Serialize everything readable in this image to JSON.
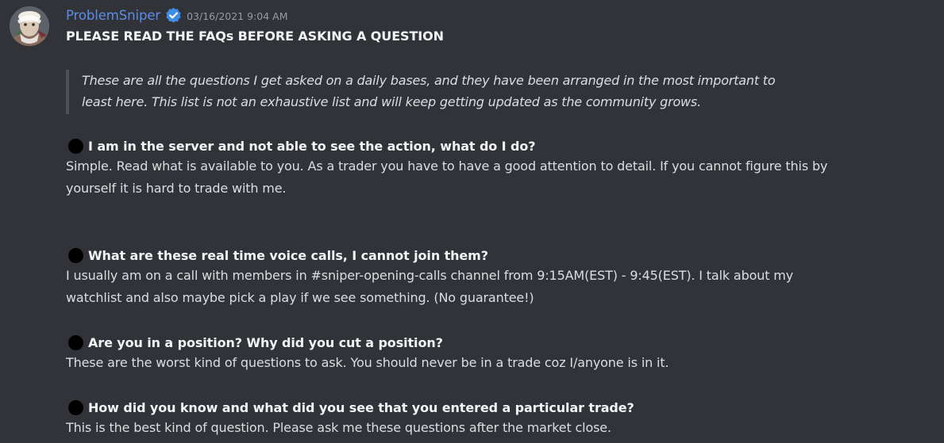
{
  "message": {
    "author": "ProblemSniper",
    "timestamp": "03/16/2021 9:04 AM",
    "avatar_icon": "avatar-image",
    "verified_icon": "verified-badge-icon",
    "title": "PLEASE READ THE FAQs BEFORE ASKING A QUESTION",
    "quote_lines": [
      "These are all the questions I get asked on a daily bases, and they have been arranged in the most important to",
      "least here. This list is not an exhaustive list and will keep getting updated as the community grows."
    ],
    "faqs": [
      {
        "question": "I am in the server and not able to see the action, what do I do?",
        "answer_lines": [
          "Simple. Read what is available to you. As a trader you have to have a good attention to detail. If you cannot figure this by",
          "yourself it is hard to trade with me."
        ]
      },
      {
        "question": "What are these real time voice calls, I cannot join them?",
        "answer_lines": [
          "I usually am on a call with members in #sniper-opening-calls channel from 9:15AM(EST) - 9:45(EST). I talk about my",
          "watchlist and also maybe pick a play if we see something. (No guarantee!)"
        ]
      },
      {
        "question": "Are you in a position? Why did you cut a position?",
        "answer_lines": [
          "These are the worst kind of questions to ask. You should never be in a trade coz I/anyone is in it."
        ]
      },
      {
        "question": "How did you know and what did you see that you entered a particular trade?",
        "answer_lines": [
          "This is the best kind of question. Please ask me these questions after the market close."
        ]
      }
    ]
  },
  "colors": {
    "background": "#313338",
    "username": "#5b8de6",
    "timestamp": "#949ba4",
    "text": "#dbdee1",
    "heading": "#f2f3f5",
    "verified_badge": "#3e8ee8",
    "quote_bar": "#4e5058",
    "bullet": "#000000"
  }
}
